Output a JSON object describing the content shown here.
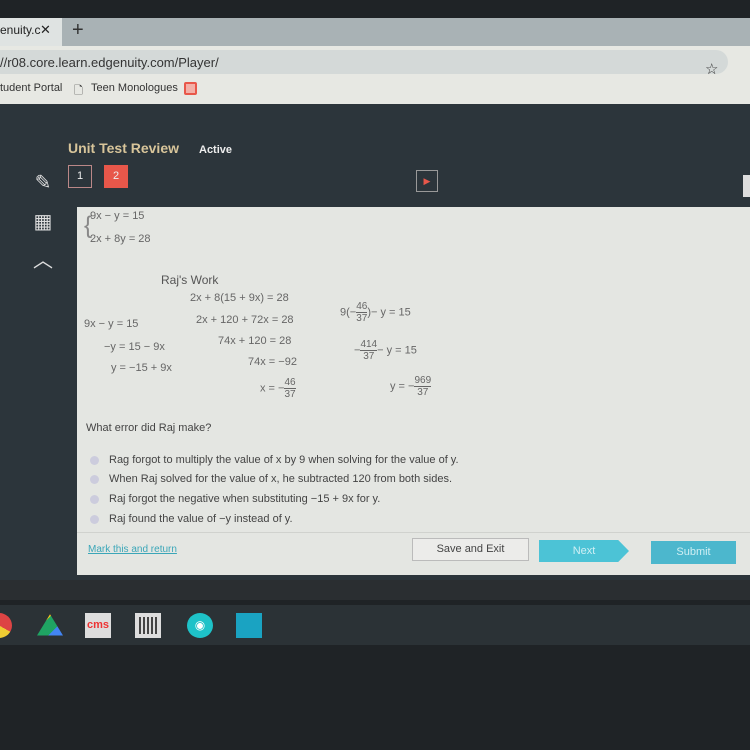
{
  "browser": {
    "tab_title": "enuity.c",
    "tab_close": "✕",
    "new_tab": "+",
    "url": "//r08.core.learn.edgenuity.com/Player/",
    "bookmarks": [
      "tudent Portal",
      "Teen Monologues"
    ]
  },
  "header": {
    "title": "Unit Test Review",
    "status": "Active",
    "questions": [
      "1",
      "2"
    ],
    "current_question": "2",
    "accent": "#e8574a"
  },
  "problem": {
    "system": [
      "9x − y = 15",
      "2x + 8y = 28"
    ],
    "work_title": "Raj's Work",
    "col1": [
      "9x − y = 15",
      "−y = 15 − 9x",
      "y = −15 + 9x"
    ],
    "col2": [
      "2x + 8(15 + 9x) = 28",
      "2x + 120 + 72x = 28",
      "74x + 120 = 28",
      "74x = −92"
    ],
    "col2_last": {
      "lhs": "x = −",
      "num": "46",
      "den": "37"
    },
    "col3": {
      "l1_pre": "9(−",
      "l1_num": "46",
      "l1_den": "37",
      "l1_post": ")− y = 15",
      "l2_pre": "−",
      "l2_num": "414",
      "l2_den": "37",
      "l2_post": "− y = 15",
      "l3_pre": "y = −",
      "l3_num": "969",
      "l3_den": "37"
    }
  },
  "question": "What error did Raj make?",
  "options": [
    "Rag forgot to multiply the value of x by 9 when solving for the value of y.",
    "When Raj solved for the value of x, he subtracted 120 from both sides.",
    "Raj forgot the negative when substituting −15 + 9x for y.",
    "Raj found the value of −y instead of y."
  ],
  "footer": {
    "mark": "Mark this and return",
    "save": "Save and Exit",
    "next": "Next",
    "submit": "Submit"
  },
  "taskbar": {
    "cms_label": "cms"
  }
}
